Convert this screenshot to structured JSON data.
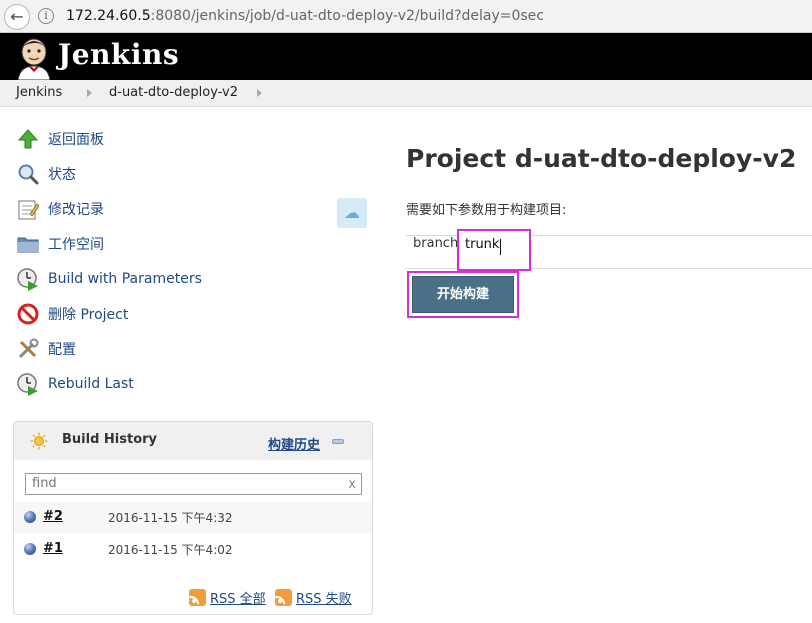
{
  "browser": {
    "url_host": "172.24.60.5",
    "url_rest": ":8080/jenkins/job/d-uat-dto-deploy-v2/build?delay=0sec"
  },
  "header": {
    "brand": "Jenkins"
  },
  "breadcrumb": {
    "items": [
      "Jenkins",
      "d-uat-dto-deploy-v2"
    ]
  },
  "sidebar": {
    "items": [
      {
        "label": "返回面板",
        "icon": "up-arrow-icon"
      },
      {
        "label": "状态",
        "icon": "magnifier-icon"
      },
      {
        "label": "修改记录",
        "icon": "notepad-icon"
      },
      {
        "label": "工作空间",
        "icon": "folder-icon"
      },
      {
        "label": "Build with Parameters",
        "icon": "clock-play-icon"
      },
      {
        "label": "删除 Project",
        "icon": "no-entry-icon"
      },
      {
        "label": "配置",
        "icon": "tools-icon"
      },
      {
        "label": "Rebuild Last",
        "icon": "clock-play-icon"
      }
    ]
  },
  "build_history": {
    "title": "Build History",
    "trend_link": "构建历史",
    "search_placeholder": "find",
    "clear": "x",
    "builds": [
      {
        "number": "#2",
        "date": "2016-11-15 下午4:32"
      },
      {
        "number": "#1",
        "date": "2016-11-15 下午4:02"
      }
    ],
    "rss_all": "RSS 全部",
    "rss_failed": "RSS 失败"
  },
  "main": {
    "title": "Project d-uat-dto-deploy-v2",
    "description": "需要如下参数用于构建项目:",
    "param_label": "branch",
    "param_value": "trunk",
    "build_button": "开始构建"
  }
}
